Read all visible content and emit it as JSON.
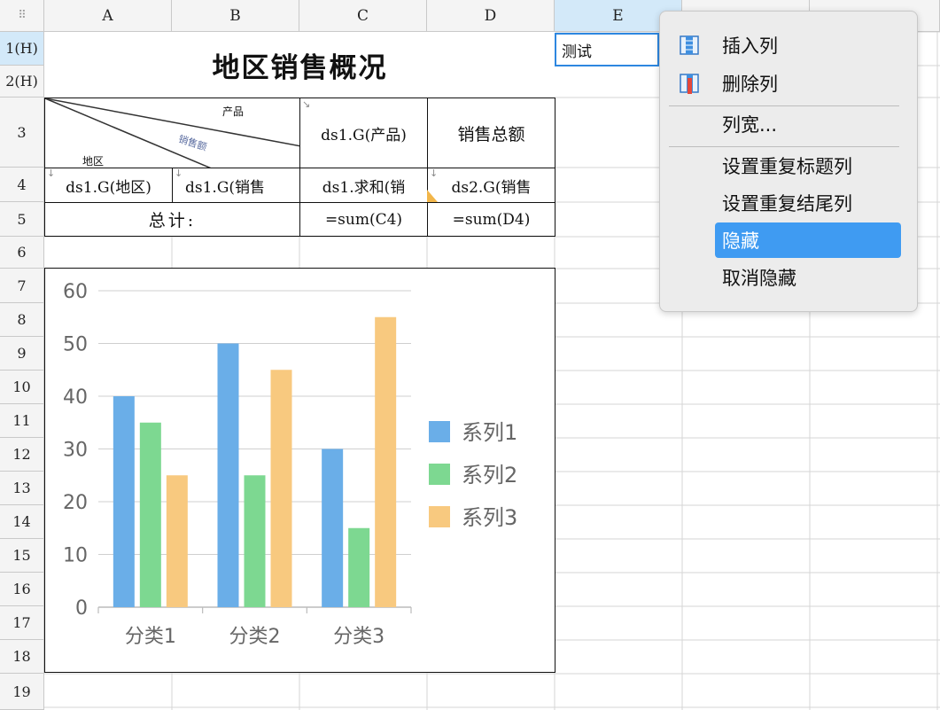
{
  "corner_icon": "grid-icon",
  "columns": [
    "A",
    "B",
    "C",
    "D",
    "E"
  ],
  "rows": [
    "1(H)",
    "2(H)",
    "3",
    "4",
    "5",
    "6",
    "7",
    "8",
    "9",
    "10",
    "11",
    "12",
    "13",
    "14",
    "15",
    "16",
    "17",
    "18",
    "19"
  ],
  "cells": {
    "title": "地区销售概况",
    "diag_product": "产品",
    "diag_sales": "销售额",
    "diag_region": "地区",
    "c3": "ds1.G(产品)",
    "d3": "销售总额",
    "a4": "ds1.G(地区)",
    "b4": "ds1.G(销售",
    "c4": "ds1.求和(销",
    "d4": "ds2.G(销售",
    "ab5": "总计:",
    "c5": "=sum(C4)",
    "d5": "=sum(D4)"
  },
  "editor_value": "测试",
  "context_menu": {
    "items": [
      {
        "label": "插入列",
        "icon": "insert-column-icon"
      },
      {
        "label": "删除列",
        "icon": "delete-column-icon"
      },
      {
        "label": "列宽..."
      },
      {
        "label": "设置重复标题列"
      },
      {
        "label": "设置重复结尾列"
      },
      {
        "label": "隐藏"
      },
      {
        "label": "取消隐藏"
      }
    ]
  },
  "colors": {
    "series1": "#6aaee8",
    "series2": "#7dd891",
    "series3": "#f8c97f",
    "selection": "#2d87e0",
    "menu_highlight": "#3f9bf2"
  },
  "chart_data": {
    "type": "bar",
    "categories": [
      "分类1",
      "分类2",
      "分类3"
    ],
    "series": [
      {
        "name": "系列1",
        "values": [
          40,
          50,
          30
        ]
      },
      {
        "name": "系列2",
        "values": [
          35,
          25,
          15
        ]
      },
      {
        "name": "系列3",
        "values": [
          25,
          45,
          55
        ]
      }
    ],
    "yticks": [
      "0",
      "10",
      "20",
      "30",
      "40",
      "50",
      "60"
    ],
    "ylim": [
      0,
      60
    ],
    "grid": true,
    "legend": "right"
  }
}
